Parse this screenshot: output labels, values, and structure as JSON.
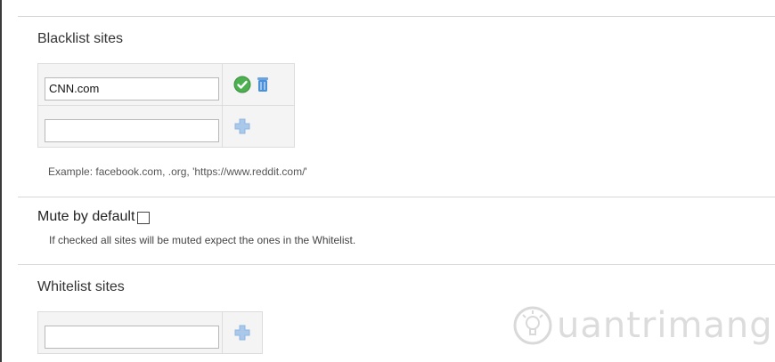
{
  "blacklist": {
    "title": "Blacklist sites",
    "rows": [
      {
        "value": "CNN.com",
        "actions": [
          "confirm-icon",
          "delete-icon"
        ]
      },
      {
        "value": "",
        "actions": [
          "add-icon"
        ]
      }
    ],
    "example": "Example: facebook.com, .org, 'https://www.reddit.com/'"
  },
  "mute": {
    "label": "Mute by default",
    "checked": false,
    "help": "If checked all sites will be muted expect the ones in the Whitelist."
  },
  "whitelist": {
    "title": "Whitelist sites",
    "rows": [
      {
        "value": "",
        "actions": [
          "add-icon"
        ]
      }
    ]
  },
  "watermark": {
    "text": "uantrimang"
  },
  "colors": {
    "confirm": "#4caf50",
    "delete": "#4a90d9",
    "add": "#a9c8ea",
    "border": "#dcdcdc",
    "cell_bg": "#f4f4f4"
  }
}
